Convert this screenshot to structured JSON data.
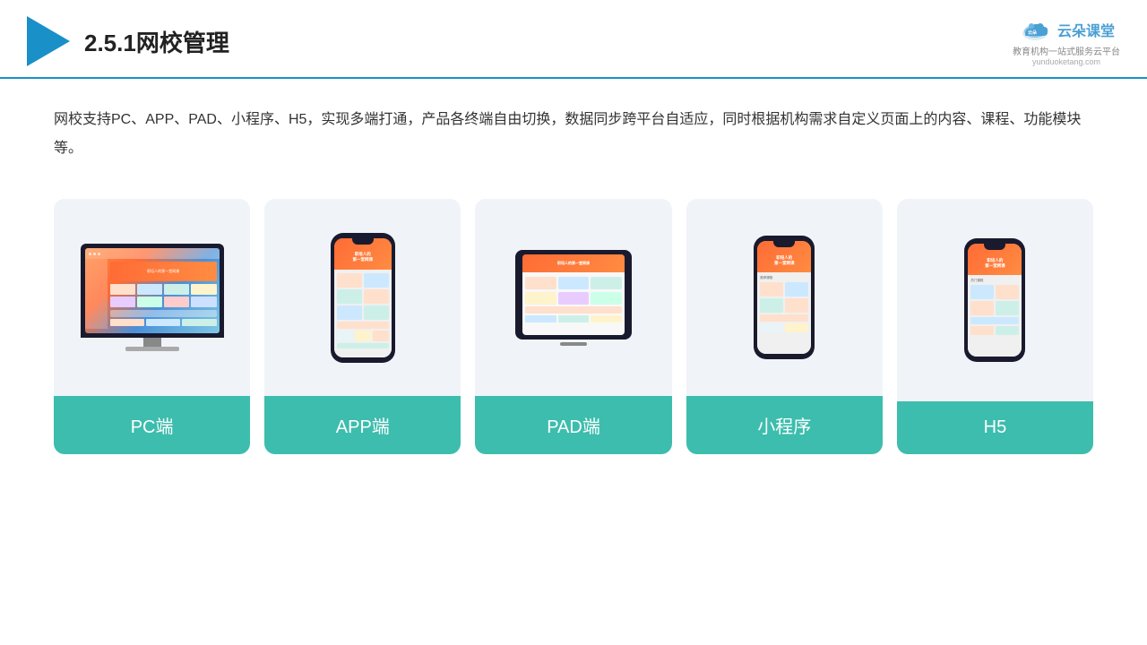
{
  "header": {
    "title": "2.5.1网校管理",
    "brand": {
      "name": "云朵课堂",
      "tagline": "教育机构一站式服务云平台",
      "url": "yunduoketang.com"
    }
  },
  "description": {
    "text": "网校支持PC、APP、PAD、小程序、H5，实现多端打通，产品各终端自由切换，数据同步跨平台自适应，同时根据机构需求自定义页面上的内容、课程、功能模块等。"
  },
  "cards": [
    {
      "id": "pc",
      "label": "PC端"
    },
    {
      "id": "app",
      "label": "APP端"
    },
    {
      "id": "pad",
      "label": "PAD端"
    },
    {
      "id": "miniprogram",
      "label": "小程序"
    },
    {
      "id": "h5",
      "label": "H5"
    }
  ],
  "colors": {
    "accent": "#3dbdad",
    "header_border": "#1a90c8",
    "triangle": "#1a90c8",
    "brand": "#4a9fd4"
  }
}
